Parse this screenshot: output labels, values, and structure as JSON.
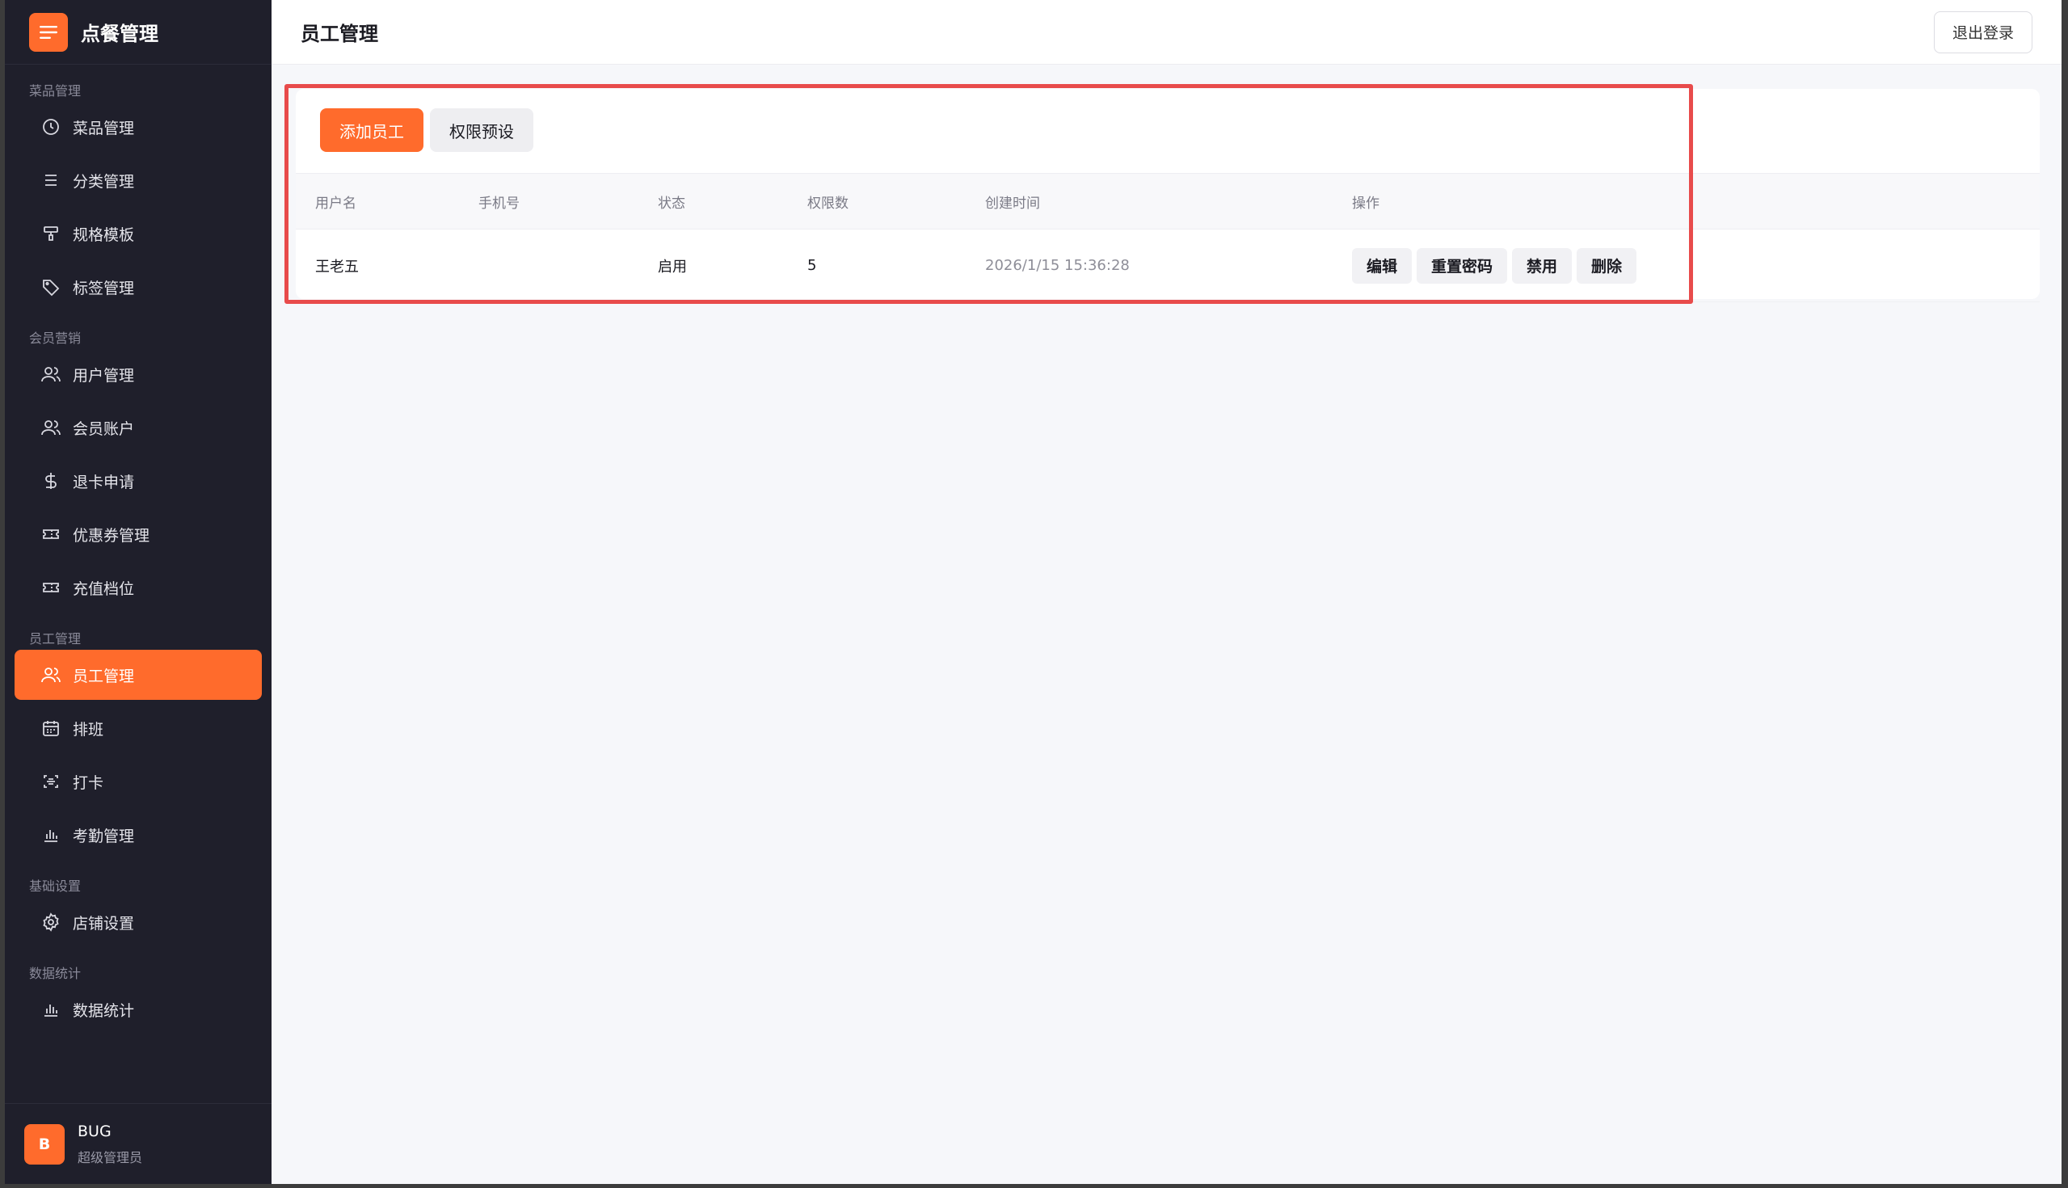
{
  "brand": {
    "title": "点餐管理",
    "icon": "menu-icon"
  },
  "sidebar": {
    "groups": [
      {
        "label": "菜品管理",
        "items": [
          {
            "label": "菜品管理",
            "icon": "clock-icon"
          },
          {
            "label": "分类管理",
            "icon": "list-icon"
          },
          {
            "label": "规格模板",
            "icon": "template-icon"
          },
          {
            "label": "标签管理",
            "icon": "tag-icon"
          }
        ]
      },
      {
        "label": "会员营销",
        "items": [
          {
            "label": "用户管理",
            "icon": "users-icon"
          },
          {
            "label": "会员账户",
            "icon": "users-icon"
          },
          {
            "label": "退卡申请",
            "icon": "dollar-icon"
          },
          {
            "label": "优惠券管理",
            "icon": "ticket-icon"
          },
          {
            "label": "充值档位",
            "icon": "ticket-icon"
          }
        ]
      },
      {
        "label": "员工管理",
        "items": [
          {
            "label": "员工管理",
            "icon": "users-icon",
            "active": true
          },
          {
            "label": "排班",
            "icon": "calendar-icon"
          },
          {
            "label": "打卡",
            "icon": "scan-icon"
          },
          {
            "label": "考勤管理",
            "icon": "bar-chart-icon"
          }
        ]
      },
      {
        "label": "基础设置",
        "items": [
          {
            "label": "店铺设置",
            "icon": "gear-icon"
          }
        ]
      },
      {
        "label": "数据统计",
        "items": [
          {
            "label": "数据统计",
            "icon": "bar-chart-icon"
          }
        ]
      }
    ]
  },
  "user": {
    "avatar_letter": "B",
    "name": "BUG",
    "role": "超级管理员"
  },
  "header": {
    "title": "员工管理",
    "logout_label": "退出登录"
  },
  "toolbar": {
    "add_label": "添加员工",
    "preset_label": "权限预设"
  },
  "table": {
    "columns": [
      "用户名",
      "手机号",
      "状态",
      "权限数",
      "创建时间",
      "操作"
    ],
    "rows": [
      {
        "username": "王老五",
        "phone": "",
        "status": "启用",
        "permissions": "5",
        "created": "2026/1/15 15:36:28",
        "actions": [
          "编辑",
          "重置密码",
          "禁用",
          "删除"
        ]
      }
    ]
  },
  "colors": {
    "accent": "#ff6b2c",
    "sidebar_bg": "#1f1f2b",
    "highlight": "#e84b4b"
  }
}
